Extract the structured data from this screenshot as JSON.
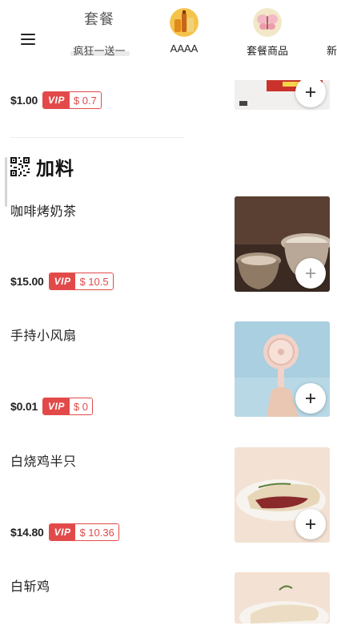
{
  "nav": {
    "categories": [
      {
        "title_art": "套餐",
        "label": "疯狂一送一",
        "icon": "taocan-calligraphy-icon"
      },
      {
        "label": "AAAA",
        "icon": "drinks-icon"
      },
      {
        "label": "套餐商品",
        "icon": "butterfly-icon"
      },
      {
        "label": "新",
        "icon": "category-icon"
      }
    ]
  },
  "colors": {
    "vip_red": "#e24a4a",
    "text": "#222222"
  },
  "vip_label": "VIP",
  "previous_item": {
    "price": "$1.00",
    "vip_price": "$ 0.7"
  },
  "section": {
    "title": "加料",
    "icon": "qr-code-icon"
  },
  "products": [
    {
      "name": "咖啡烤奶茶",
      "price": "$15.00",
      "vip_price": "$ 10.5"
    },
    {
      "name": "手持小风扇",
      "price": "$0.01",
      "vip_price": "$ 0"
    },
    {
      "name": "白烧鸡半只",
      "price": "$14.80",
      "vip_price": "$ 10.36"
    },
    {
      "name": "白斩鸡"
    }
  ]
}
